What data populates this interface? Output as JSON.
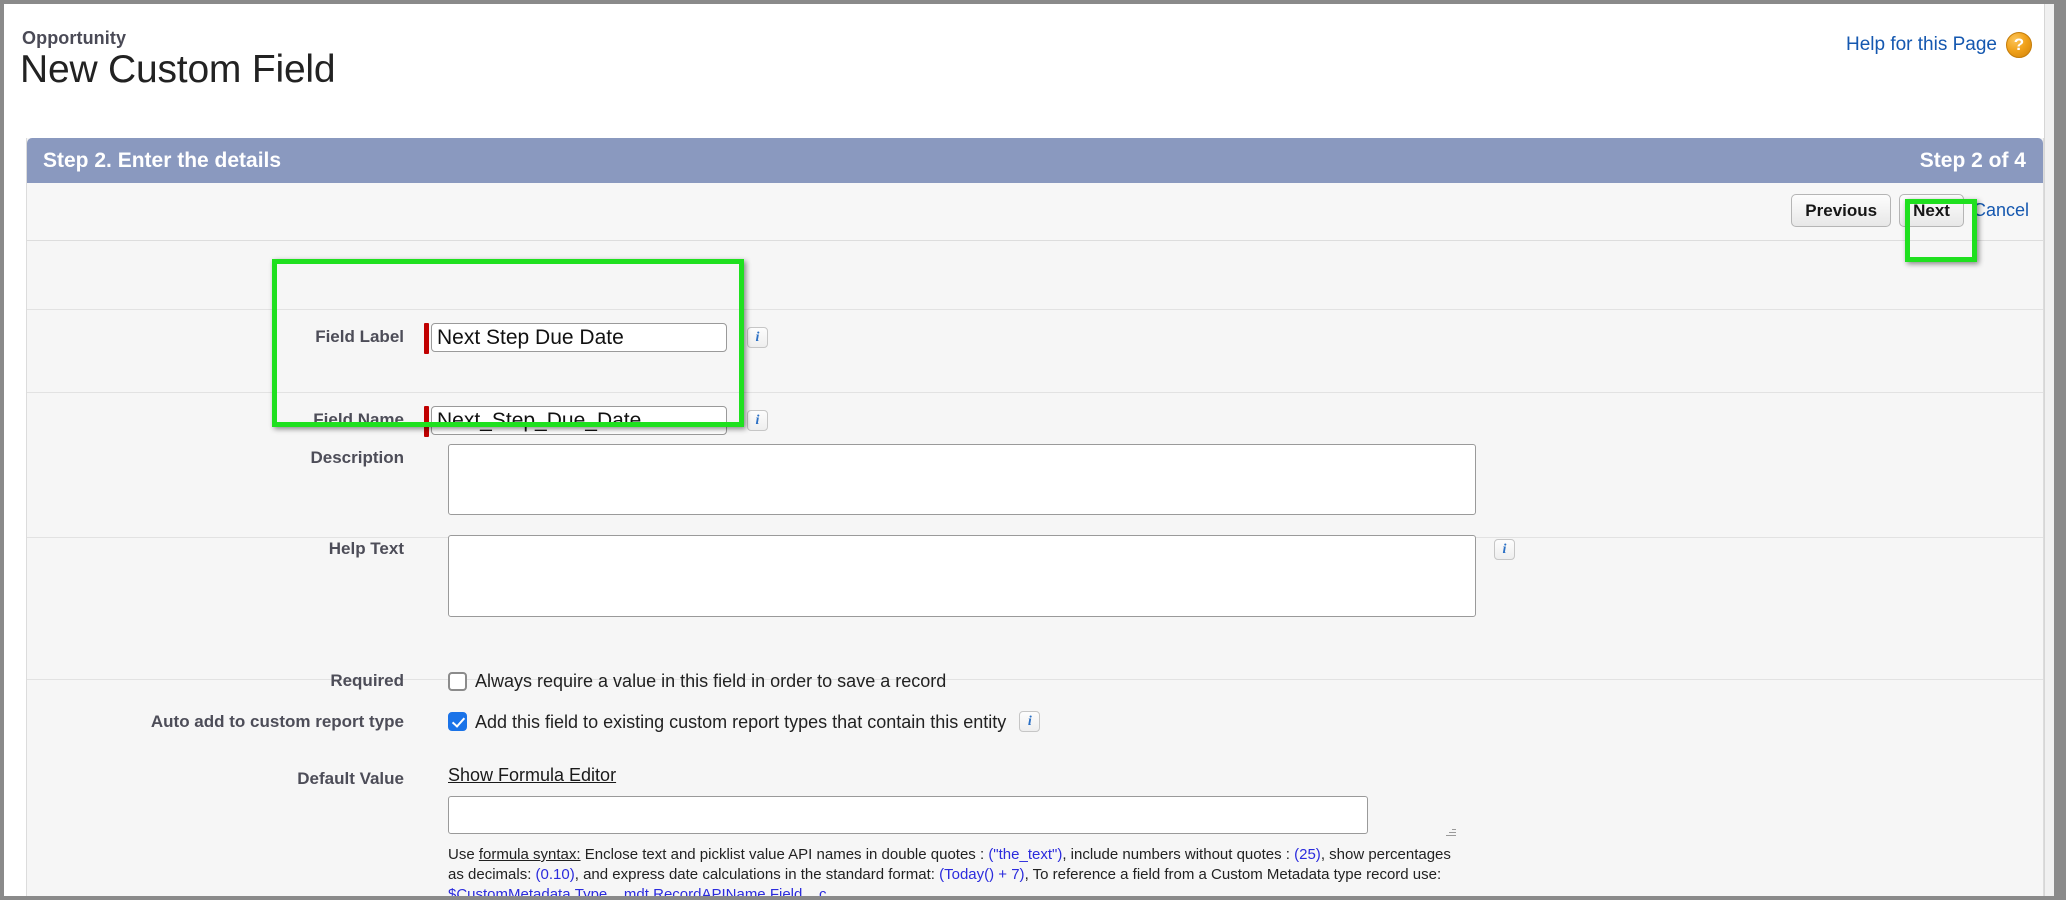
{
  "header": {
    "breadcrumb": "Opportunity",
    "title": "New Custom Field",
    "help_link": "Help for this Page",
    "help_icon": "question-mark-icon"
  },
  "wizard": {
    "step_title": "Step 2. Enter the details",
    "step_count": "Step 2 of 4",
    "accent_color": "#8a99bf"
  },
  "actions": {
    "previous": "Previous",
    "next": "Next",
    "cancel": "Cancel"
  },
  "form": {
    "field_label": {
      "label": "Field Label",
      "value": "Next Step Due Date",
      "required": true,
      "info": "i"
    },
    "field_name": {
      "label": "Field Name",
      "value": "Next_Step_Due_Date",
      "required": true,
      "info": "i"
    },
    "description": {
      "label": "Description",
      "value": "",
      "placeholder": ""
    },
    "help_text": {
      "label": "Help Text",
      "value": "",
      "placeholder": "",
      "info": "i"
    },
    "required_row": {
      "label": "Required",
      "checkbox_label": "Always require a value in this field in order to save a record",
      "checked": false
    },
    "auto_add_row": {
      "label": "Auto add to custom report type",
      "checkbox_label": "Add this field to existing custom report types that contain this entity",
      "checked": true,
      "info": "i"
    },
    "default_value": {
      "label": "Default Value",
      "formula_editor_link": "Show Formula Editor",
      "value": "",
      "hint": {
        "lead_plain": "Use ",
        "lead_underline": "formula syntax:",
        "part1": " Enclose text and picklist value API names in double quotes : ",
        "code1": "(\"the_text\")",
        "part2": ", include numbers without quotes : ",
        "code2": "(25)",
        "part3": ", show percentages as decimals: ",
        "code3": "(0.10)",
        "part4": ", and express date calculations in the standard format: ",
        "code4": "(Today() + 7)",
        "part5": ", To reference a field from a Custom Metadata type record use: ",
        "code5": "$CustomMetadata.Type__mdt.RecordAPIName.Field__c"
      }
    }
  },
  "annotations": {
    "field_rows_highlight": "green-rectangle-fields",
    "next_button_highlight": "green-rectangle-next-button",
    "color": "#1fe01f"
  }
}
